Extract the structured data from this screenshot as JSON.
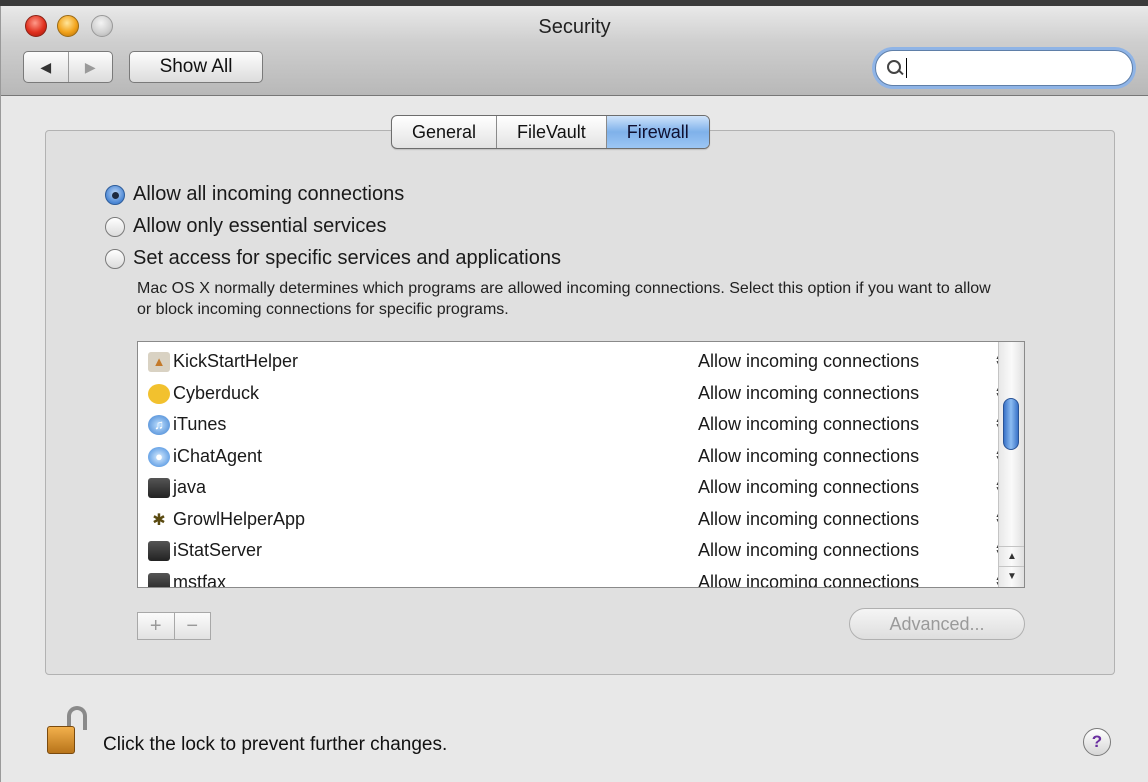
{
  "window": {
    "title": "Security"
  },
  "toolbar": {
    "back_glyph": "◀",
    "forward_glyph": "▶",
    "show_all_label": "Show All"
  },
  "search": {
    "value": "",
    "placeholder": ""
  },
  "tabs": [
    {
      "label": "General",
      "active": false
    },
    {
      "label": "FileVault",
      "active": false
    },
    {
      "label": "Firewall",
      "active": true
    }
  ],
  "firewall": {
    "options": [
      {
        "label": "Allow all incoming connections",
        "selected": true
      },
      {
        "label": "Allow only essential services",
        "selected": false
      },
      {
        "label": "Set access for specific services and applications",
        "selected": false
      }
    ],
    "description": "Mac OS X normally determines which programs are allowed incoming connections. Select this option if you want to allow or block incoming connections for specific programs.",
    "apps": [
      {
        "name": "KickStartHelper",
        "permission": "Allow incoming connections",
        "icon": "kickstart-icon"
      },
      {
        "name": "Cyberduck",
        "permission": "Allow incoming connections",
        "icon": "cyberduck-icon"
      },
      {
        "name": "iTunes",
        "permission": "Allow incoming connections",
        "icon": "itunes-icon"
      },
      {
        "name": "iChatAgent",
        "permission": "Allow incoming connections",
        "icon": "ichat-icon"
      },
      {
        "name": "java",
        "permission": "Allow incoming connections",
        "icon": "terminal-executable-icon"
      },
      {
        "name": "GrowlHelperApp",
        "permission": "Allow incoming connections",
        "icon": "growl-icon"
      },
      {
        "name": "iStatServer",
        "permission": "Allow incoming connections",
        "icon": "terminal-executable-icon"
      },
      {
        "name": "mstfax",
        "permission": "Allow incoming connections",
        "icon": "terminal-executable-icon"
      }
    ],
    "add_label": "+",
    "remove_label": "−",
    "advanced_label": "Advanced..."
  },
  "footer": {
    "lock_text": "Click the lock to prevent further changes.",
    "help_label": "?"
  },
  "colors": {
    "accent": "#7fb1ea",
    "selected_radio": "#4a86d4"
  }
}
